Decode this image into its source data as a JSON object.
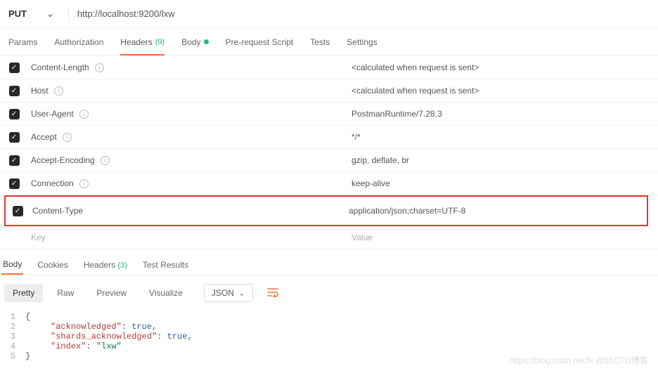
{
  "request": {
    "method": "PUT",
    "url": "http://localhost:9200/lxw"
  },
  "tabs": {
    "params": "Params",
    "auth": "Authorization",
    "headers": "Headers",
    "headers_count": "(9)",
    "body": "Body",
    "prerequest": "Pre-request Script",
    "tests": "Tests",
    "settings": "Settings"
  },
  "headers": [
    {
      "key": "Content-Length",
      "value": "<calculated when request is sent>",
      "info": true
    },
    {
      "key": "Host",
      "value": "<calculated when request is sent>",
      "info": true
    },
    {
      "key": "User-Agent",
      "value": "PostmanRuntime/7.28.3",
      "info": true
    },
    {
      "key": "Accept",
      "value": "*/*",
      "info": true
    },
    {
      "key": "Accept-Encoding",
      "value": "gzip, deflate, br",
      "info": true
    },
    {
      "key": "Connection",
      "value": "keep-alive",
      "info": true
    },
    {
      "key": "Content-Type",
      "value": "application/json;charset=UTF-8",
      "info": false
    }
  ],
  "placeholders": {
    "key": "Key",
    "value": "Value"
  },
  "response_tabs": {
    "body": "Body",
    "cookies": "Cookies",
    "headers": "Headers",
    "headers_count": "(3)",
    "tests": "Test Results"
  },
  "view_modes": {
    "pretty": "Pretty",
    "raw": "Raw",
    "preview": "Preview",
    "visualize": "Visualize",
    "format": "JSON"
  },
  "response_body": {
    "lines": [
      "1",
      "2",
      "3",
      "4",
      "5"
    ],
    "kv": [
      {
        "k": "\"acknowledged\"",
        "v": "true",
        "t": "bool"
      },
      {
        "k": "\"shards_acknowledged\"",
        "v": "true",
        "t": "bool"
      },
      {
        "k": "\"index\"",
        "v": "\"lxw\"",
        "t": "str"
      }
    ]
  },
  "watermark": "https://blog.csdn.net/lx  @51CTO博客"
}
